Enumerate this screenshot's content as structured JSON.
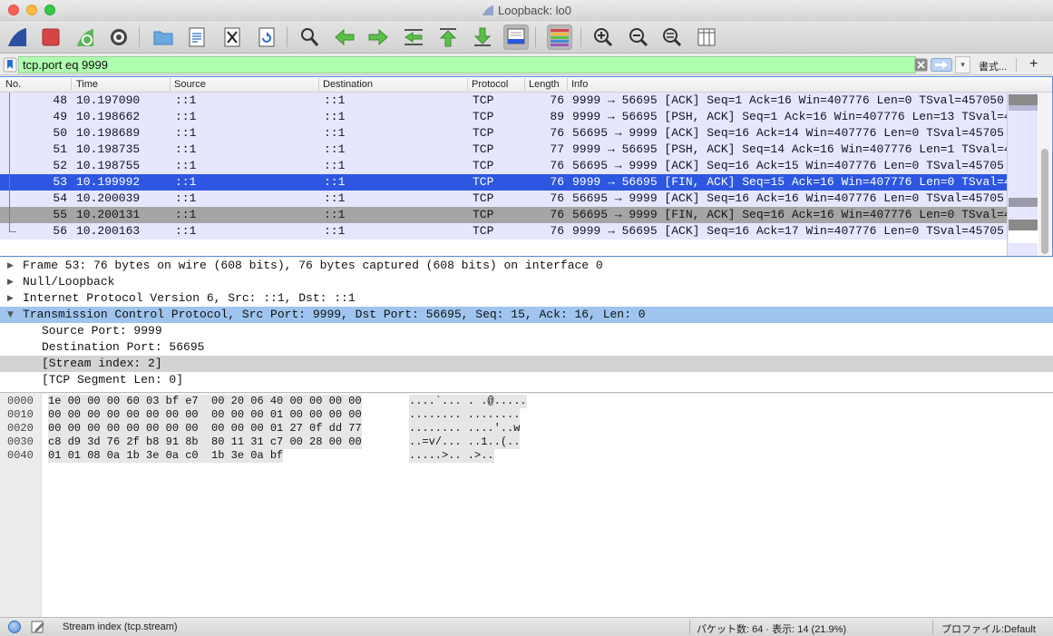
{
  "window": {
    "title": "Loopback: lo0"
  },
  "toolbar": {
    "buttons": [
      {
        "name": "start-capture-icon"
      },
      {
        "name": "stop-capture-icon"
      },
      {
        "name": "restart-capture-icon"
      },
      {
        "name": "capture-options-icon"
      },
      {
        "name": "open-file-icon"
      },
      {
        "name": "save-file-icon"
      },
      {
        "name": "close-file-icon"
      },
      {
        "name": "reload-file-icon"
      },
      {
        "name": "find-packet-icon"
      },
      {
        "name": "go-back-icon"
      },
      {
        "name": "go-forward-icon"
      },
      {
        "name": "go-to-packet-icon"
      },
      {
        "name": "go-first-icon"
      },
      {
        "name": "go-last-icon"
      },
      {
        "name": "autoscroll-icon"
      },
      {
        "name": "colorize-icon"
      },
      {
        "name": "zoom-in-icon"
      },
      {
        "name": "zoom-out-icon"
      },
      {
        "name": "zoom-normal-icon"
      },
      {
        "name": "resize-columns-icon"
      }
    ],
    "colors": {
      "shark_fin": "#2a4fa3",
      "stop": "#d64545",
      "green": "#3fae3f"
    }
  },
  "filter": {
    "value": "tcp.port eq 9999",
    "format_label": "書式...",
    "add_label": "+",
    "dropdown_label": "▾",
    "valid_color": "#afffaf"
  },
  "packet_list": {
    "columns": [
      "No.",
      "Time",
      "Source",
      "Destination",
      "Protocol",
      "Length",
      "Info"
    ],
    "rows": [
      {
        "no": "48",
        "time": "10.197090",
        "src": "::1",
        "dst": "::1",
        "proto": "TCP",
        "len": "76",
        "info": "9999 → 56695 [ACK] Seq=1 Ack=16 Win=407776 Len=0 TSval=457050",
        "state": "normal"
      },
      {
        "no": "49",
        "time": "10.198662",
        "src": "::1",
        "dst": "::1",
        "proto": "TCP",
        "len": "89",
        "info": "9999 → 56695 [PSH, ACK] Seq=1 Ack=16 Win=407776 Len=13 TSval=4",
        "state": "normal"
      },
      {
        "no": "50",
        "time": "10.198689",
        "src": "::1",
        "dst": "::1",
        "proto": "TCP",
        "len": "76",
        "info": "56695 → 9999 [ACK] Seq=16 Ack=14 Win=407776 Len=0 TSval=45705",
        "state": "normal"
      },
      {
        "no": "51",
        "time": "10.198735",
        "src": "::1",
        "dst": "::1",
        "proto": "TCP",
        "len": "77",
        "info": "9999 → 56695 [PSH, ACK] Seq=14 Ack=16 Win=407776 Len=1 TSval=4",
        "state": "normal"
      },
      {
        "no": "52",
        "time": "10.198755",
        "src": "::1",
        "dst": "::1",
        "proto": "TCP",
        "len": "76",
        "info": "56695 → 9999 [ACK] Seq=16 Ack=15 Win=407776 Len=0 TSval=45705",
        "state": "normal"
      },
      {
        "no": "53",
        "time": "10.199992",
        "src": "::1",
        "dst": "::1",
        "proto": "TCP",
        "len": "76",
        "info": "9999 → 56695 [FIN, ACK] Seq=15 Ack=16 Win=407776 Len=0 TSval=4",
        "state": "selected"
      },
      {
        "no": "54",
        "time": "10.200039",
        "src": "::1",
        "dst": "::1",
        "proto": "TCP",
        "len": "76",
        "info": "56695 → 9999 [ACK] Seq=16 Ack=16 Win=407776 Len=0 TSval=45705",
        "state": "normal"
      },
      {
        "no": "55",
        "time": "10.200131",
        "src": "::1",
        "dst": "::1",
        "proto": "TCP",
        "len": "76",
        "info": "56695 → 9999 [FIN, ACK] Seq=16 Ack=16 Win=407776 Len=0 TSval=4",
        "state": "dim"
      },
      {
        "no": "56",
        "time": "10.200163",
        "src": "::1",
        "dst": "::1",
        "proto": "TCP",
        "len": "76",
        "info": "9999 → 56695 [ACK] Seq=16 Ack=17 Win=407776 Len=0 TSval=45705",
        "state": "normal"
      }
    ],
    "row_colors": {
      "normal": "#e7e6ff",
      "selected": "#2d57e0",
      "dim": "#a5a5a5"
    }
  },
  "details": {
    "rows": [
      {
        "text": "Frame 53: 76 bytes on wire (608 bits), 76 bytes captured (608 bits) on interface 0",
        "arrow": "▶",
        "indent": 0,
        "state": "normal"
      },
      {
        "text": "Null/Loopback",
        "arrow": "▶",
        "indent": 0,
        "state": "normal"
      },
      {
        "text": "Internet Protocol Version 6, Src: ::1, Dst: ::1",
        "arrow": "▶",
        "indent": 0,
        "state": "normal"
      },
      {
        "text": "Transmission Control Protocol, Src Port: 9999, Dst Port: 56695, Seq: 15, Ack: 16, Len: 0",
        "arrow": "▼",
        "indent": 0,
        "state": "selected"
      },
      {
        "text": "Source Port: 9999",
        "arrow": "",
        "indent": 1,
        "state": "normal"
      },
      {
        "text": "Destination Port: 56695",
        "arrow": "",
        "indent": 1,
        "state": "normal"
      },
      {
        "text": "[Stream index: 2]",
        "arrow": "",
        "indent": 1,
        "state": "highlight"
      },
      {
        "text": "[TCP Segment Len: 0]",
        "arrow": "",
        "indent": 1,
        "state": "normal"
      }
    ]
  },
  "bytes": {
    "rows": [
      {
        "offset": "0000",
        "hex": "1e 00 00 00 60 03 bf e7  00 20 06 40 00 00 00 00",
        "ascii": "....`... . .@....."
      },
      {
        "offset": "0010",
        "hex": "00 00 00 00 00 00 00 00  00 00 00 01 00 00 00 00",
        "ascii": "........ ........"
      },
      {
        "offset": "0020",
        "hex": "00 00 00 00 00 00 00 00  00 00 00 01 27 0f dd 77",
        "ascii": "........ ....'..w"
      },
      {
        "offset": "0030",
        "hex": "c8 d9 3d 76 2f b8 91 8b  80 11 31 c7 00 28 00 00",
        "ascii": "..=v/... ..1..(.."
      },
      {
        "offset": "0040",
        "hex": "01 01 08 0a 1b 3e 0a c0  1b 3e 0a bf",
        "ascii": ".....>.. .>.."
      }
    ]
  },
  "status": {
    "field_text": "Stream index (tcp.stream)",
    "packets_text": "パケット数: 64 · 表示: 14 (21.9%)",
    "profile_text": "プロファイル:Default"
  }
}
